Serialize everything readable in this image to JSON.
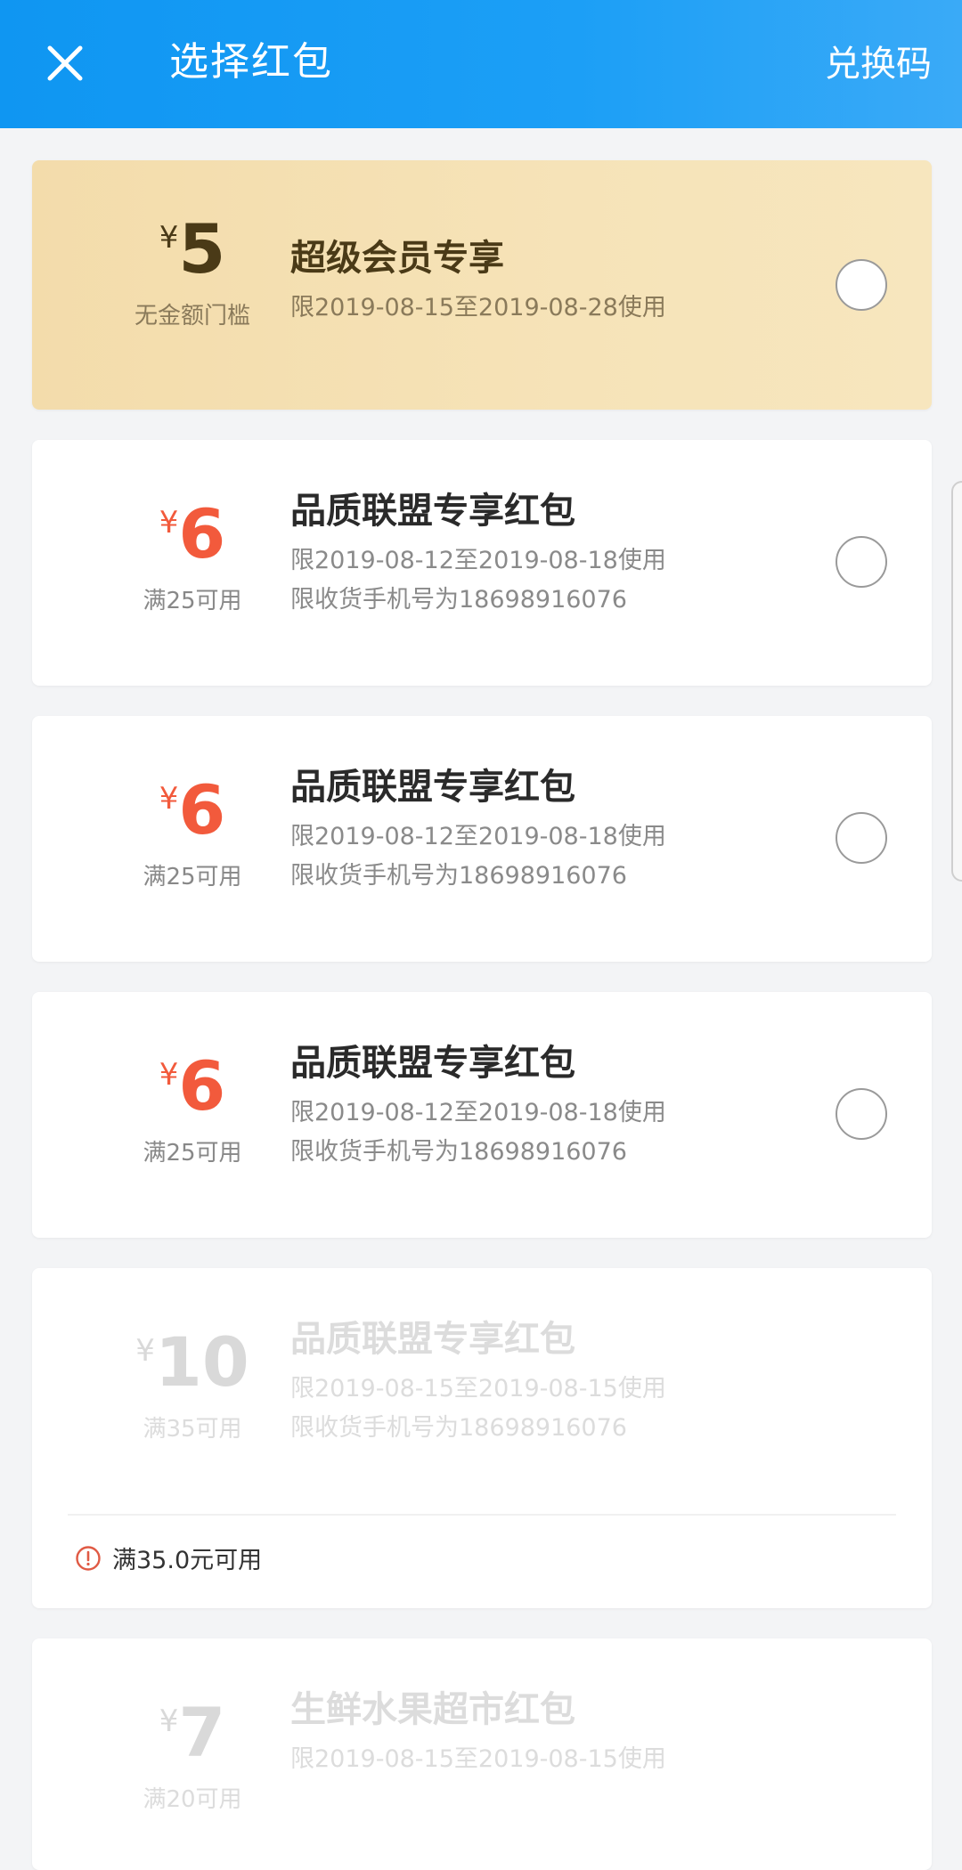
{
  "header": {
    "title": "选择红包",
    "action_label": "兑换码"
  },
  "coupons": [
    {
      "yen": "¥",
      "amount": "5",
      "condition": "无金额门槛",
      "title": "超级会员专享",
      "line1": "限2019-08-15至2019-08-28使用",
      "line2": ""
    },
    {
      "yen": "¥",
      "amount": "6",
      "condition": "满25可用",
      "title": "品质联盟专享红包",
      "line1": "限2019-08-12至2019-08-18使用",
      "line2": "限收货手机号为18698916076"
    },
    {
      "yen": "¥",
      "amount": "6",
      "condition": "满25可用",
      "title": "品质联盟专享红包",
      "line1": "限2019-08-12至2019-08-18使用",
      "line2": "限收货手机号为18698916076"
    },
    {
      "yen": "¥",
      "amount": "6",
      "condition": "满25可用",
      "title": "品质联盟专享红包",
      "line1": "限2019-08-12至2019-08-18使用",
      "line2": "限收货手机号为18698916076"
    },
    {
      "yen": "¥",
      "amount": "10",
      "condition": "满35可用",
      "title": "品质联盟专享红包",
      "line1": "限2019-08-15至2019-08-15使用",
      "line2": "限收货手机号为18698916076",
      "warning": "满35.0元可用"
    },
    {
      "yen": "¥",
      "amount": "7",
      "condition": "满20可用",
      "title": "生鲜水果超市红包",
      "line1": "限2019-08-15至2019-08-15使用",
      "line2": ""
    }
  ],
  "colors": {
    "header_blue": "#1c9ff6",
    "coupon_red": "#f25a3c",
    "gold_bg": "#f5e1b5"
  }
}
